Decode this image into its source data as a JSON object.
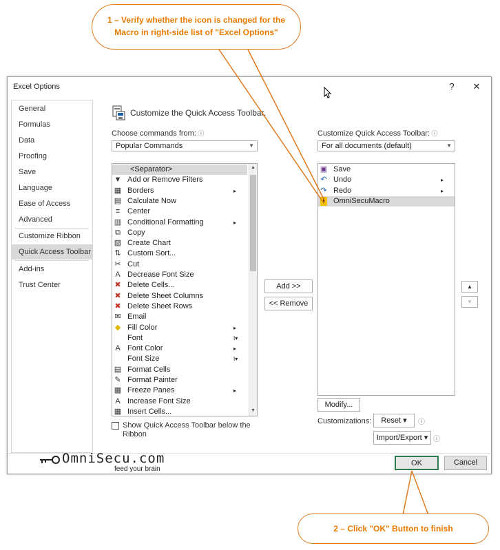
{
  "window": {
    "title": "Excel Options",
    "help": "?",
    "close": "✕"
  },
  "annotations": {
    "top": "1 – Verify whether the icon is  changed for the Macro in right-side list of \"Excel Options\"",
    "bottom": "2 – Click \"OK\" Button to finish"
  },
  "sidebar": {
    "items": [
      "General",
      "Formulas",
      "Data",
      "Proofing",
      "Save",
      "Language",
      "Ease of Access",
      "Advanced",
      "Customize Ribbon",
      "Quick Access Toolbar",
      "Add-ins",
      "Trust Center"
    ],
    "selected": "Quick Access Toolbar"
  },
  "header": {
    "text": "Customize the Quick Access Toolbar."
  },
  "left": {
    "choose_label": "Choose commands from:",
    "choose_value": "Popular Commands",
    "items": [
      {
        "label": "<Separator>",
        "icon": "",
        "sub": ""
      },
      {
        "label": "Add or Remove Filters",
        "icon": "▼",
        "sub": ""
      },
      {
        "label": "Borders",
        "icon": "▦",
        "sub": "▸"
      },
      {
        "label": "Calculate Now",
        "icon": "▤",
        "sub": ""
      },
      {
        "label": "Center",
        "icon": "≡",
        "sub": ""
      },
      {
        "label": "Conditional Formatting",
        "icon": "▥",
        "sub": "▸"
      },
      {
        "label": "Copy",
        "icon": "⧉",
        "sub": ""
      },
      {
        "label": "Create Chart",
        "icon": "▧",
        "sub": ""
      },
      {
        "label": "Custom Sort...",
        "icon": "⇅",
        "sub": ""
      },
      {
        "label": "Cut",
        "icon": "✂",
        "sub": ""
      },
      {
        "label": "Decrease Font Size",
        "icon": "A",
        "sub": ""
      },
      {
        "label": "Delete Cells...",
        "icon": "✖",
        "sub": ""
      },
      {
        "label": "Delete Sheet Columns",
        "icon": "✖",
        "sub": ""
      },
      {
        "label": "Delete Sheet Rows",
        "icon": "✖",
        "sub": ""
      },
      {
        "label": "Email",
        "icon": "✉",
        "sub": ""
      },
      {
        "label": "Fill Color",
        "icon": "◆",
        "sub": "▸"
      },
      {
        "label": "Font",
        "icon": "",
        "sub": "I▾"
      },
      {
        "label": "Font Color",
        "icon": "A",
        "sub": "▸"
      },
      {
        "label": "Font Size",
        "icon": "",
        "sub": "I▾"
      },
      {
        "label": "Format Cells",
        "icon": "▤",
        "sub": ""
      },
      {
        "label": "Format Painter",
        "icon": "✎",
        "sub": ""
      },
      {
        "label": "Freeze Panes",
        "icon": "▦",
        "sub": "▸"
      },
      {
        "label": "Increase Font Size",
        "icon": "A",
        "sub": ""
      },
      {
        "label": "Insert Cells...",
        "icon": "▦",
        "sub": ""
      }
    ],
    "show_below_label": "Show Quick Access Toolbar below the Ribbon"
  },
  "middle": {
    "add": "Add >>",
    "remove": "<< Remove"
  },
  "right": {
    "customize_label": "Customize Quick Access Toolbar:",
    "doc_value": "For all documents (default)",
    "items": [
      {
        "label": "Save",
        "icon": "▣",
        "sub": ""
      },
      {
        "label": "Undo",
        "icon": "↶",
        "sub": "▸"
      },
      {
        "label": "Redo",
        "icon": "↷",
        "sub": "▸"
      },
      {
        "label": "OmniSecuMacro",
        "icon": "!",
        "sub": ""
      }
    ],
    "modify": "Modify...",
    "customizations_label": "Customizations:",
    "reset": "Reset ▾",
    "import_export": "Import/Export ▾",
    "info": "ⓘ"
  },
  "footer": {
    "ok": "OK",
    "cancel": "Cancel"
  },
  "logo": {
    "name": "OmniSecu.com",
    "tagline": "feed your brain"
  },
  "colors": {
    "accent_orange": "#e07a1e",
    "selected_gray": "#d9d9d9",
    "ok_border": "#2a7c4f",
    "icon_blue": "#1f5fa8"
  }
}
